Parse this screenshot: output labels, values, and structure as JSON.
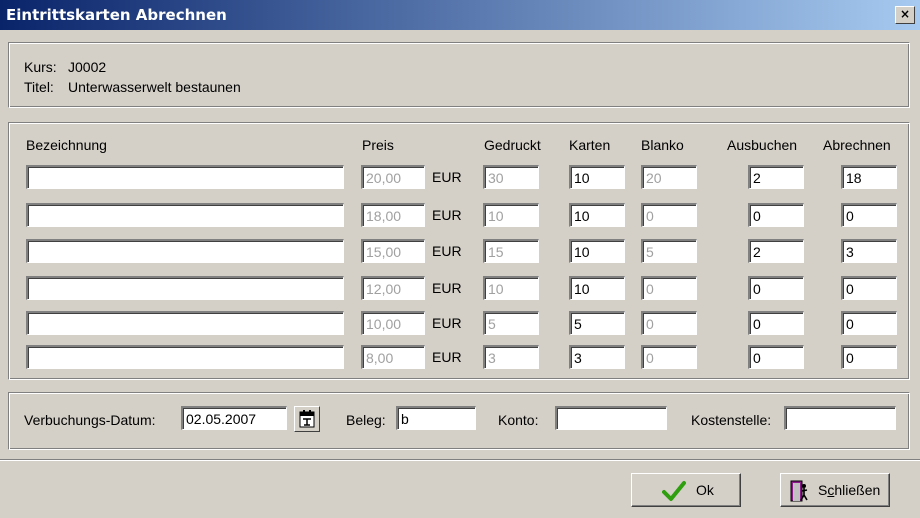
{
  "window": {
    "title": "Eintrittskarten Abrechnen",
    "close_label": "×"
  },
  "info": {
    "kurs_label": "Kurs:",
    "kurs_value": "J0002",
    "titel_label": "Titel:",
    "titel_value": "Unterwasserwelt bestaunen"
  },
  "table": {
    "headers": {
      "bezeichnung": "Bezeichnung",
      "preis": "Preis",
      "gedruckt": "Gedruckt",
      "karten": "Karten",
      "blanko": "Blanko",
      "ausbuchen": "Ausbuchen",
      "abrechnen": "Abrechnen"
    },
    "rows": [
      {
        "bezeichnung": "",
        "preis": "20,00",
        "currency": "EUR",
        "gedruckt": "30",
        "karten": "10",
        "blanko": "20",
        "ausbuchen": "2",
        "abrechnen": "18"
      },
      {
        "bezeichnung": "",
        "preis": "18,00",
        "currency": "EUR",
        "gedruckt": "10",
        "karten": "10",
        "blanko": "0",
        "ausbuchen": "0",
        "abrechnen": "0"
      },
      {
        "bezeichnung": "",
        "preis": "15,00",
        "currency": "EUR",
        "gedruckt": "15",
        "karten": "10",
        "blanko": "5",
        "ausbuchen": "2",
        "abrechnen": "3"
      },
      {
        "bezeichnung": "",
        "preis": "12,00",
        "currency": "EUR",
        "gedruckt": "10",
        "karten": "10",
        "blanko": "0",
        "ausbuchen": "0",
        "abrechnen": "0"
      },
      {
        "bezeichnung": "",
        "preis": "10,00",
        "currency": "EUR",
        "gedruckt": "5",
        "karten": "5",
        "blanko": "0",
        "ausbuchen": "0",
        "abrechnen": "0"
      },
      {
        "bezeichnung": "",
        "preis": "8,00",
        "currency": "EUR",
        "gedruckt": "3",
        "karten": "3",
        "blanko": "0",
        "ausbuchen": "0",
        "abrechnen": "0"
      }
    ]
  },
  "booking": {
    "datum_label": "Verbuchungs-Datum:",
    "datum_value": "02.05.2007",
    "beleg_label": "Beleg:",
    "beleg_value": "b",
    "konto_label": "Konto:",
    "konto_value": "",
    "kostenstelle_label": "Kostenstelle:",
    "kostenstelle_value": ""
  },
  "buttons": {
    "ok_label": "Ok",
    "close_prefix": "S",
    "close_underline": "c",
    "close_suffix": "hließen"
  },
  "icons": {
    "ok": "checkmark-icon",
    "close": "door-exit-icon",
    "calendar": "calendar-icon"
  },
  "colors": {
    "titlebar_start": "#0a246a",
    "titlebar_end": "#a6caf0",
    "checkmark": "#2f9e0f",
    "door": "#8b1a8b"
  }
}
